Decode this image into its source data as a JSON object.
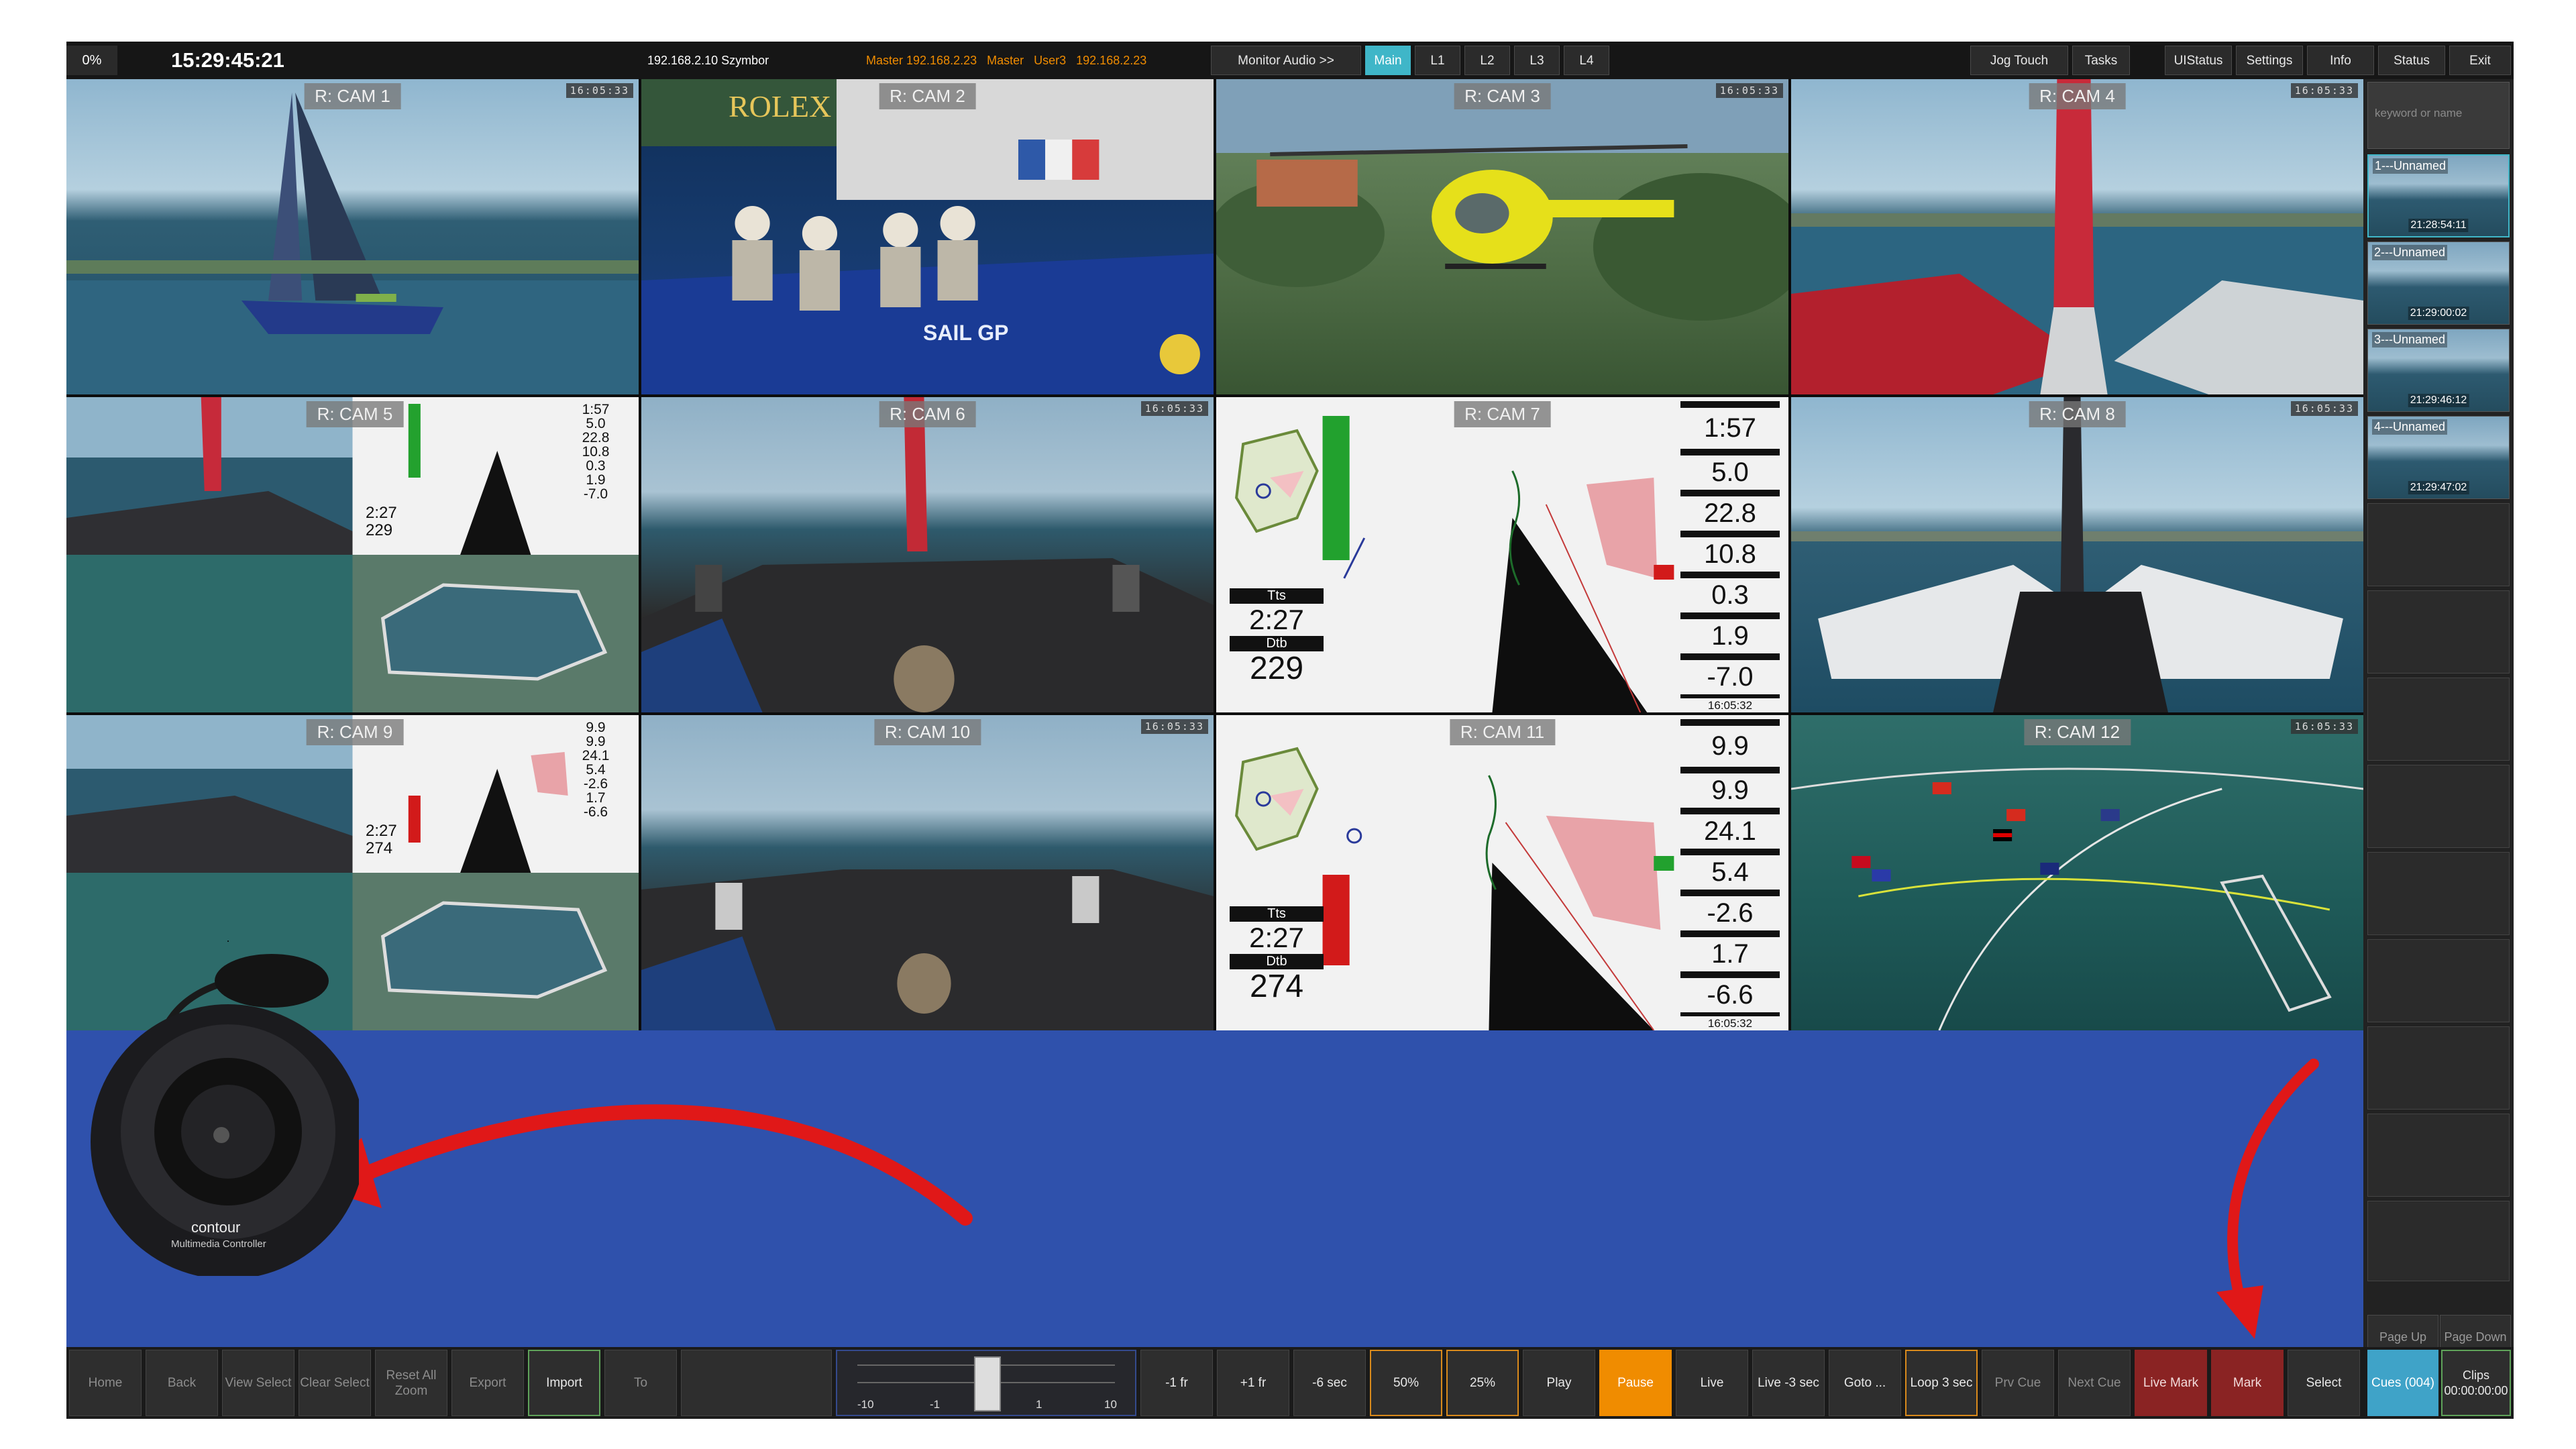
{
  "topbar": {
    "progress": "0%",
    "clock": "15:29:45:21",
    "host": "192.168.2.10 Szymbor",
    "master_info": "Master 192.168.2.23   Master   User3   192.168.2.23",
    "buttons": {
      "monitor_audio": "Monitor Audio >>",
      "main": "Main",
      "l1": "L1",
      "l2": "L2",
      "l3": "L3",
      "l4": "L4",
      "jog_touch": "Jog Touch",
      "tasks": "Tasks",
      "uistatus": "UIStatus",
      "settings": "Settings",
      "info": "Info",
      "status": "Status",
      "exit": "Exit"
    }
  },
  "cameras": [
    {
      "label": "R: CAM 1",
      "tc": "16:05:33"
    },
    {
      "label": "R: CAM 2",
      "tc": ""
    },
    {
      "label": "R: CAM 3",
      "tc": "16:05:33"
    },
    {
      "label": "R: CAM 4",
      "tc": "16:05:33"
    },
    {
      "label": "R: CAM 5",
      "tc": ""
    },
    {
      "label": "R: CAM 6",
      "tc": "16:05:33"
    },
    {
      "label": "R: CAM 7",
      "tc": ""
    },
    {
      "label": "R: CAM 8",
      "tc": "16:05:33"
    },
    {
      "label": "R: CAM 9",
      "tc": ""
    },
    {
      "label": "R: CAM 10",
      "tc": "16:05:33"
    },
    {
      "label": "R: CAM 11",
      "tc": ""
    },
    {
      "label": "R: CAM 12",
      "tc": "16:05:33"
    }
  ],
  "cam2_text": {
    "brand": "ROLEX",
    "sponsor": "SAIL GP"
  },
  "telemetry7": {
    "values": [
      "1:57",
      "5.0",
      "22.8",
      "10.8",
      "0.3",
      "1.9",
      "-7.0"
    ],
    "tts_label": "Tts",
    "tts": "2:27",
    "dtb_label": "Dtb",
    "dtb": "229",
    "time": "16:05:32"
  },
  "telemetry11": {
    "values": [
      "9.9",
      "9.9",
      "24.1",
      "5.4",
      "-2.6",
      "1.7",
      "-6.6"
    ],
    "tts_label": "Tts",
    "tts": "2:27",
    "dtb_label": "Dtb",
    "dtb": "274",
    "time": "16:05:32"
  },
  "mini5": {
    "values": [
      "1:57",
      "5.0",
      "22.8",
      "10.8",
      "0.3",
      "1.9",
      "-7.0"
    ],
    "tts": "2:27",
    "dtb": "229"
  },
  "mini9": {
    "values": [
      "9.9",
      "9.9",
      "24.1",
      "5.4",
      "-2.6",
      "1.7",
      "-6.6"
    ],
    "tts": "2:27",
    "dtb": "274"
  },
  "controller": {
    "brand": "contour",
    "model": "Multimedia Controller"
  },
  "sidebar": {
    "search_placeholder": "keyword or name",
    "cues": [
      {
        "name": "1---Unnamed",
        "time": "21:28:54:11"
      },
      {
        "name": "2---Unnamed",
        "time": "21:29:00:02"
      },
      {
        "name": "3---Unnamed",
        "time": "21:29:46:12"
      },
      {
        "name": "4---Unnamed",
        "time": "21:29:47:02"
      }
    ],
    "page_up": "Page Up",
    "page_down": "Page Down"
  },
  "bottombar": {
    "home": "Home",
    "back": "Back",
    "view_select": "View Select",
    "clear_select": "Clear Select",
    "reset_all_zoom": "Reset All Zoom",
    "export": "Export",
    "import": "Import",
    "to": "To",
    "jog_ticks": [
      "-10",
      "-1",
      "1",
      "10"
    ],
    "jog_position": 0.5,
    "minus_1fr": "-1 fr",
    "plus_1fr": "+1 fr",
    "minus_6sec": "-6 sec",
    "speed50": "50%",
    "speed25": "25%",
    "play": "Play",
    "pause": "Pause",
    "live": "Live",
    "live_minus3": "Live -3 sec",
    "goto": "Goto ...",
    "loop": "Loop 3 sec",
    "prv_cue": "Prv Cue",
    "next_cue": "Next Cue",
    "live_mark": "Live Mark",
    "mark": "Mark",
    "select": "Select",
    "cues": "Cues (004)",
    "clips": "Clips 00:00:00:00"
  },
  "colors": {
    "accent": "#3fb6c8",
    "highlight": "#f08c00",
    "mark": "#8a2323",
    "overlay_blue": "#2f51ac",
    "arrow": "#e01818"
  }
}
